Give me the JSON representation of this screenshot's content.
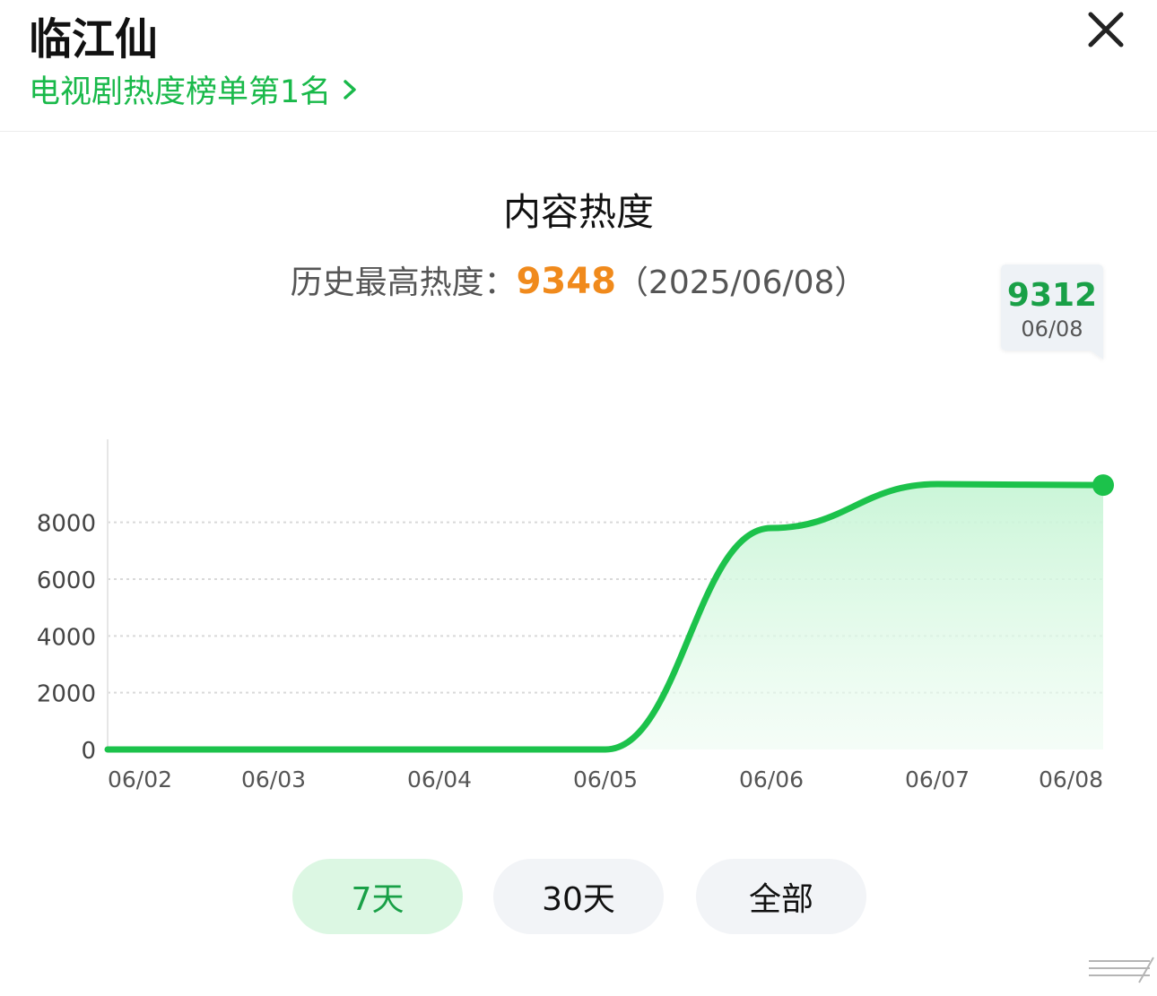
{
  "header": {
    "title": "临江仙",
    "rank_text": "电视剧热度榜单第1名"
  },
  "main": {
    "section_title": "内容热度",
    "hist_label": "历史最高热度：",
    "hist_value": "9348",
    "hist_date": "（2025/06/08）"
  },
  "tabs": [
    {
      "label": "7天",
      "active": true
    },
    {
      "label": "30天",
      "active": false
    },
    {
      "label": "全部",
      "active": false
    }
  ],
  "colors": {
    "accent": "#19b94a",
    "line": "#1cc24b",
    "highlight": "#f08a1c"
  },
  "chart_data": {
    "type": "area",
    "x": [
      "06/02",
      "06/03",
      "06/04",
      "06/05",
      "06/06",
      "06/07",
      "06/08"
    ],
    "series": [
      {
        "values": [
          0,
          0,
          0,
          0,
          7800,
          9348,
          9312
        ]
      }
    ],
    "ylim": [
      0,
      9348
    ],
    "yticks": [
      0,
      2000,
      4000,
      6000,
      8000
    ],
    "grid": true,
    "tooltip": {
      "value": "9312",
      "date": "06/08"
    }
  }
}
